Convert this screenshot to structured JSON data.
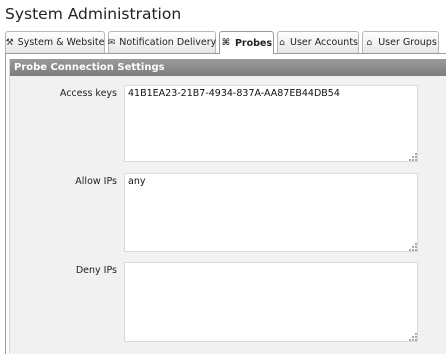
{
  "page": {
    "title": "System Administration"
  },
  "tabs": [
    {
      "label": "System & Website",
      "icon": "wrench-icon",
      "glyph": "⚒",
      "active": false
    },
    {
      "label": "Notification Delivery",
      "icon": "envelope-icon",
      "glyph": "✉",
      "active": false
    },
    {
      "label": "Probes",
      "icon": "probe-icon",
      "glyph": "⌘",
      "active": true
    },
    {
      "label": "User Accounts",
      "icon": "user-icon",
      "glyph": "⌂",
      "active": false
    },
    {
      "label": "User Groups",
      "icon": "users-icon",
      "glyph": "⌂",
      "active": false
    }
  ],
  "section": {
    "title": "Probe Connection Settings"
  },
  "fields": {
    "access_keys": {
      "label": "Access keys",
      "value": "41B1EA23-21B7-4934-837A-AA87EB44DB54"
    },
    "allow_ips": {
      "label": "Allow IPs",
      "value": "any"
    },
    "deny_ips": {
      "label": "Deny IPs",
      "value": ""
    }
  },
  "colors": {
    "section_header": "#8a8a8a",
    "panel_bg": "#f1f1f1"
  }
}
